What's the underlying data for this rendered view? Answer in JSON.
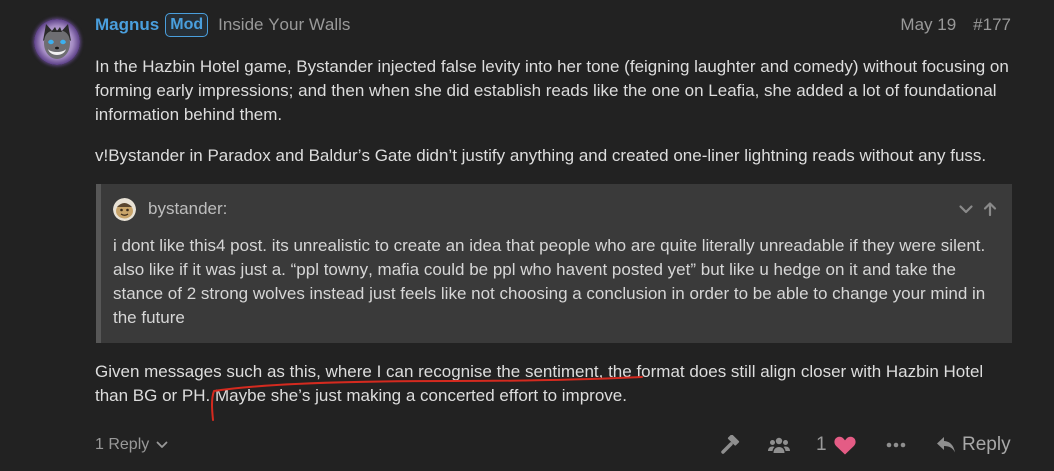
{
  "post": {
    "author": {
      "username": "Magnus",
      "badge": "Mod",
      "user_title": "Inside Your Walls",
      "avatar_icon": "wolf-avatar"
    },
    "date": "May 19",
    "post_number": "#177",
    "body_before_quote": [
      "In the Hazbin Hotel game, Bystander injected false levity into her tone (feigning laughter and comedy) without focusing on forming early impressions; and then when she did establish reads like the one on Leafia, she added a lot of foundational information behind them.",
      "v!Bystander in Paradox and Baldur’s Gate didn’t justify anything and created one-liner lightning reads without any fuss."
    ],
    "quote": {
      "username": "bystander:",
      "avatar_icon": "bystander-avatar",
      "text": "i dont like this4 post. its unrealistic to create an idea that people who are quite literally unreadable if they were silent. also like if it was just a. “ppl towny, mafia could be ppl who havent posted yet” but like u hedge on it and take the stance of 2 strong wolves instead just feels like not choosing a conclusion in order to be able to change your mind in the future",
      "control_icons": [
        "chevron-down-icon",
        "arrow-up-icon"
      ]
    },
    "body_after_quote": [
      "Given messages such as this, where I can recognise the sentiment, the format does still align closer with Hazbin Hotel than BG or PH. Maybe she’s just making a concerted effort to improve."
    ],
    "footer": {
      "replies_label": "1 Reply",
      "like_count": "1",
      "reply_label": "Reply",
      "action_icons": [
        "hammer-icon",
        "users-icon",
        "heart-icon",
        "more-dots-icon",
        "reply-arrow-icon"
      ]
    }
  },
  "colors": {
    "background": "#222222",
    "text": "#dddddd",
    "muted": "#999999",
    "accent": "#4a9fdd",
    "quote_background": "#3a3a3a",
    "quote_border": "#575757",
    "heart": "#e45c85",
    "annotation": "#d42a1f"
  }
}
